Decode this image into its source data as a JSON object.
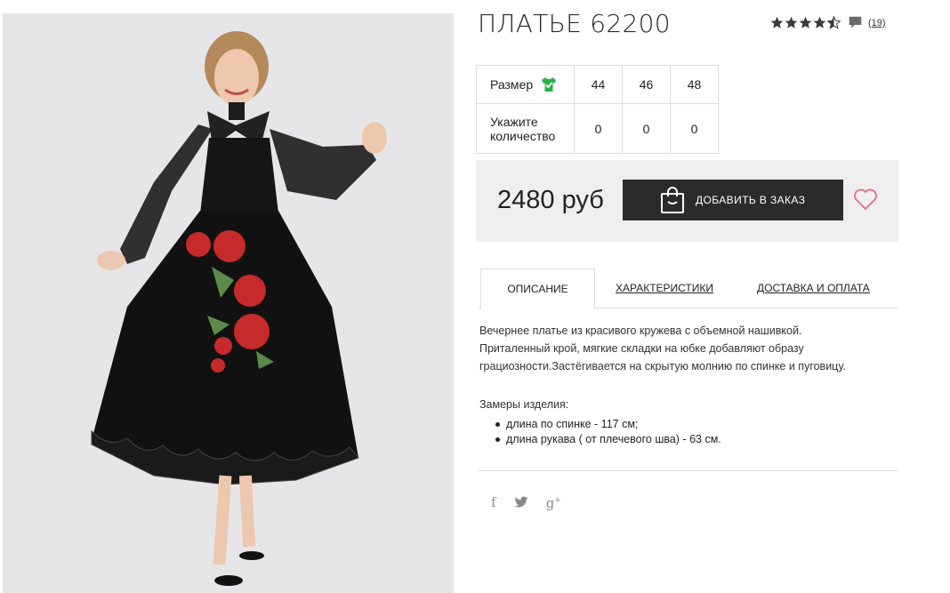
{
  "product": {
    "title": "ПЛАТЬЕ 62200",
    "rating": 4.5,
    "review_count": "(19)",
    "price": "2480 руб",
    "add_button_label": "ДОБАВИТЬ В ЗАКАЗ"
  },
  "size_table": {
    "size_label": "Размер",
    "qty_label_line1": "Укажите",
    "qty_label_line2": "количество",
    "sizes": [
      "44",
      "46",
      "48"
    ],
    "quantities": [
      "0",
      "0",
      "0"
    ]
  },
  "tabs": [
    {
      "label": "ОПИСАНИЕ",
      "active": true
    },
    {
      "label": "ХАРАКТЕРИСТИКИ",
      "active": false
    },
    {
      "label": "ДОСТАВКА И ОПЛАТА",
      "active": false
    }
  ],
  "description": {
    "line1": "Вечернее платье из красивого кружева с объемной нашивкой.",
    "line2": "Приталенный крой, мягкие складки на юбке добавляют образу",
    "line3": "грациозности.Застёгивается на скрытую молнию по спинке и пуговицу.",
    "measures_title": "Замеры изделия:",
    "measures": [
      "длина по спинке - 117 см;",
      "длина рукава ( от плечевого шва) - 63 см."
    ]
  },
  "social": {
    "facebook": "f",
    "twitter": "🐦",
    "gplus": "g"
  },
  "colors": {
    "button_bg": "#2b2b2b",
    "heart": "#e07a8a",
    "shirt_icon": "#27b24a",
    "buybox_bg": "#efefef"
  },
  "icons": [
    "star-icon",
    "comment-icon",
    "shirt-check-icon",
    "shopping-bag-icon",
    "heart-icon",
    "facebook-icon",
    "twitter-icon",
    "google-plus-icon"
  ]
}
